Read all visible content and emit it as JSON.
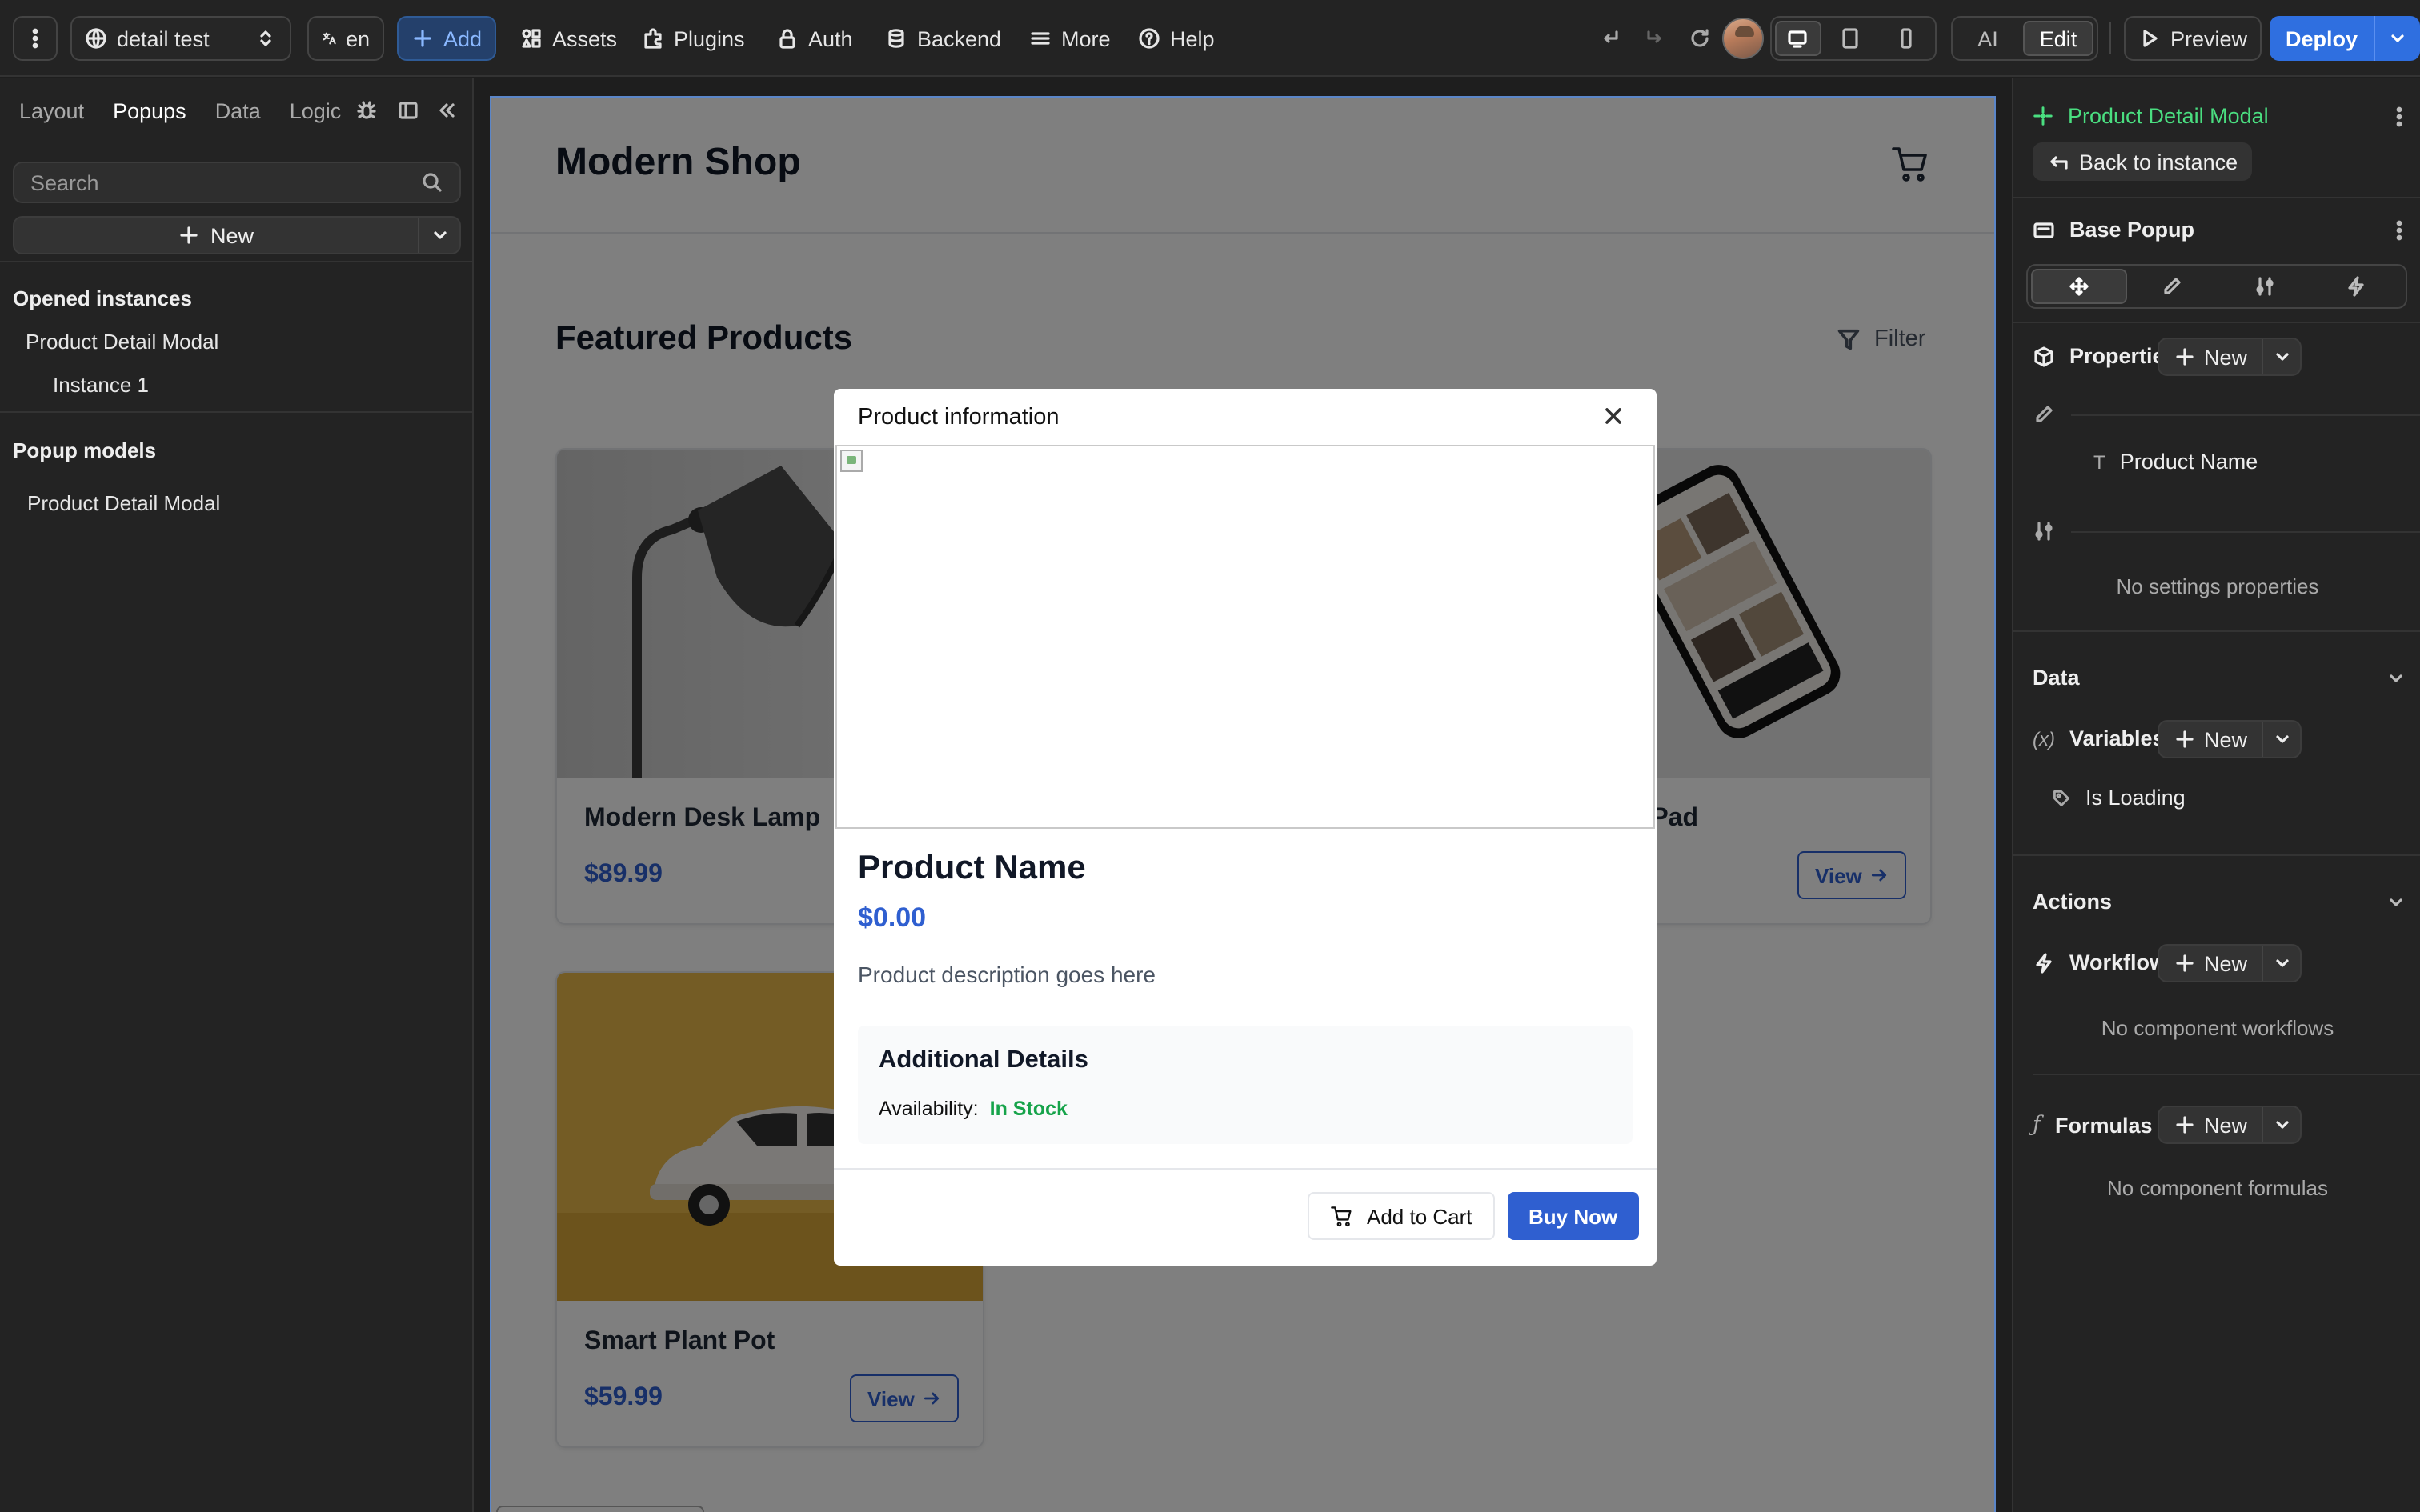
{
  "topbar": {
    "project_name": "detail test",
    "language": "en",
    "add_label": "Add",
    "assets_label": "Assets",
    "plugins_label": "Plugins",
    "auth_label": "Auth",
    "backend_label": "Backend",
    "more_label": "More",
    "help_label": "Help",
    "ai_label": "AI",
    "edit_label": "Edit",
    "preview_label": "Preview",
    "deploy_label": "Deploy",
    "accent_color": "#2f6fe0"
  },
  "left_panel": {
    "tabs": [
      {
        "label": "Layout",
        "active": false
      },
      {
        "label": "Popups",
        "active": true
      },
      {
        "label": "Data",
        "active": false
      },
      {
        "label": "Logic",
        "active": false
      }
    ],
    "search_placeholder": "Search",
    "new_label": "New",
    "opened_instances_title": "Opened instances",
    "opened_instance": "Product Detail Modal",
    "instance_child": "Instance 1",
    "popup_models_title": "Popup models",
    "popup_model": "Product Detail Modal"
  },
  "canvas": {
    "shop_title": "Modern Shop",
    "featured_title": "Featured Products",
    "filter_label": "Filter",
    "products": [
      {
        "name": "Modern Desk Lamp",
        "price": "$89.99"
      },
      {
        "name": "Charging Pad",
        "view_label": "View"
      },
      {
        "name": "Smart Plant Pot",
        "price": "$59.99",
        "view_label": "View"
      }
    ],
    "price_color": "#2f5fd0"
  },
  "modal": {
    "title": "Product information",
    "product_name": "Product Name",
    "price": "$0.00",
    "description": "Product description goes here",
    "details_title": "Additional Details",
    "availability_label": "Availability:",
    "availability_value": "In Stock",
    "availability_color": "#16a34a",
    "add_to_cart_label": "Add to Cart",
    "buy_now_label": "Buy Now"
  },
  "right_panel": {
    "component_name": "Product Detail Modal",
    "component_color": "#4ade80",
    "back_label": "Back to instance",
    "base_popup_label": "Base Popup",
    "properties_label": "Properties",
    "new_label": "New",
    "product_name_prop": "Product Name",
    "no_settings": "No settings properties",
    "data_title": "Data",
    "variables_label": "Variables",
    "is_loading_var": "Is Loading",
    "actions_title": "Actions",
    "workflows_label": "Workflows",
    "no_workflows": "No component workflows",
    "formulas_label": "Formulas",
    "no_formulas": "No component formulas"
  }
}
